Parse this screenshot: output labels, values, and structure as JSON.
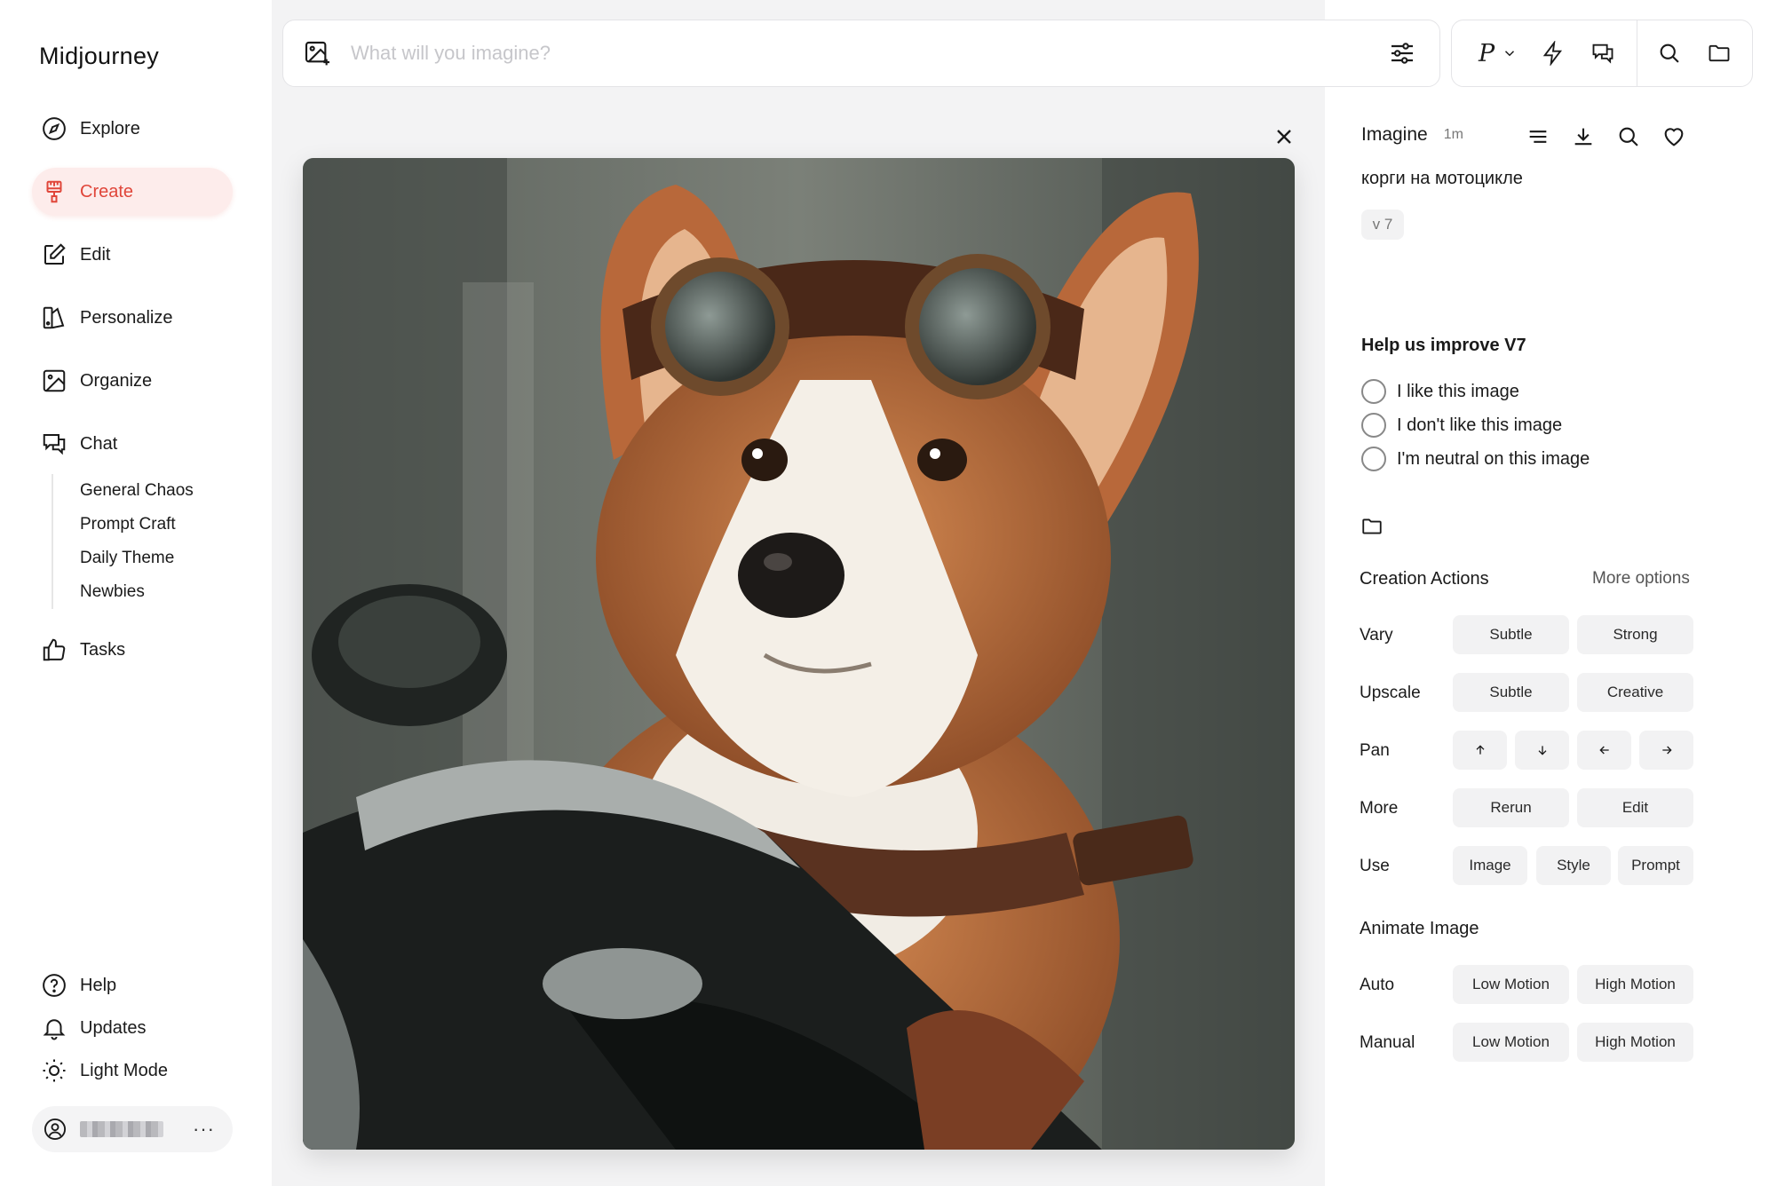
{
  "app": {
    "title": "Midjourney"
  },
  "sidebar": {
    "items": [
      {
        "label": "Explore",
        "icon": "compass-icon"
      },
      {
        "label": "Create",
        "icon": "brush-icon",
        "active": true
      },
      {
        "label": "Edit",
        "icon": "edit-icon"
      },
      {
        "label": "Personalize",
        "icon": "personalize-icon"
      },
      {
        "label": "Organize",
        "icon": "image-icon"
      },
      {
        "label": "Chat",
        "icon": "chat-icon"
      }
    ],
    "chat_channels": [
      "General Chaos",
      "Prompt Craft",
      "Daily Theme",
      "Newbies"
    ],
    "tasks": "Tasks",
    "bottom": [
      {
        "label": "Help",
        "icon": "help-icon"
      },
      {
        "label": "Updates",
        "icon": "bell-icon"
      },
      {
        "label": "Light Mode",
        "icon": "sun-icon"
      }
    ],
    "more_label": "···"
  },
  "search": {
    "placeholder": "What will you imagine?",
    "value": ""
  },
  "toolbar": {
    "personalize_label": "P"
  },
  "panel": {
    "title": "Imagine",
    "time": "1m",
    "prompt": "корги на мотоцикле",
    "version": "v 7",
    "improve_title": "Help us improve V7",
    "feedback": [
      "I like this image",
      "I don't like this image",
      "I'm neutral on this image"
    ],
    "creation_actions": "Creation Actions",
    "more_options": "More options",
    "vary": {
      "label": "Vary",
      "subtle": "Subtle",
      "strong": "Strong"
    },
    "upscale": {
      "label": "Upscale",
      "subtle": "Subtle",
      "creative": "Creative"
    },
    "pan": {
      "label": "Pan"
    },
    "more": {
      "label": "More",
      "rerun": "Rerun",
      "edit": "Edit"
    },
    "use": {
      "label": "Use",
      "image": "Image",
      "style": "Style",
      "prompt": "Prompt"
    },
    "animate_title": "Animate Image",
    "auto": {
      "label": "Auto",
      "low": "Low Motion",
      "high": "High Motion"
    },
    "manual": {
      "label": "Manual",
      "low": "Low Motion",
      "high": "High Motion"
    }
  },
  "colors": {
    "accent": "#e0463a",
    "accent_bg": "#fdeceb",
    "main_bg": "#f3f3f4",
    "button_bg": "#f2f2f3"
  }
}
